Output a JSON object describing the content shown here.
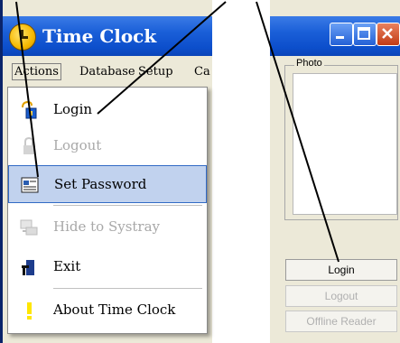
{
  "app": {
    "title": "Time Clock"
  },
  "menubar": {
    "items": [
      "Actions",
      "Database",
      "Setup",
      "Ca"
    ]
  },
  "menu": {
    "items": [
      {
        "label": "Login",
        "icon": "login-key-icon",
        "disabled": false
      },
      {
        "label": "Logout",
        "icon": "lock-icon",
        "disabled": true
      },
      {
        "label": "Set Password",
        "icon": "password-icon",
        "disabled": false,
        "selected": true
      },
      {
        "label": "Hide to Systray",
        "icon": "systray-icon",
        "disabled": true
      },
      {
        "label": "Exit",
        "icon": "exit-door-icon",
        "disabled": false
      },
      {
        "label": "About Time Clock",
        "icon": "info-icon",
        "disabled": false
      }
    ]
  },
  "right": {
    "photo_label": "Photo",
    "buttons": {
      "login": "Login",
      "logout": "Logout",
      "offline": "Offline Reader"
    }
  },
  "colors": {
    "titlebar": "#0c4ecb",
    "selected": "#c1d2ee",
    "accent": "#316ac5"
  }
}
